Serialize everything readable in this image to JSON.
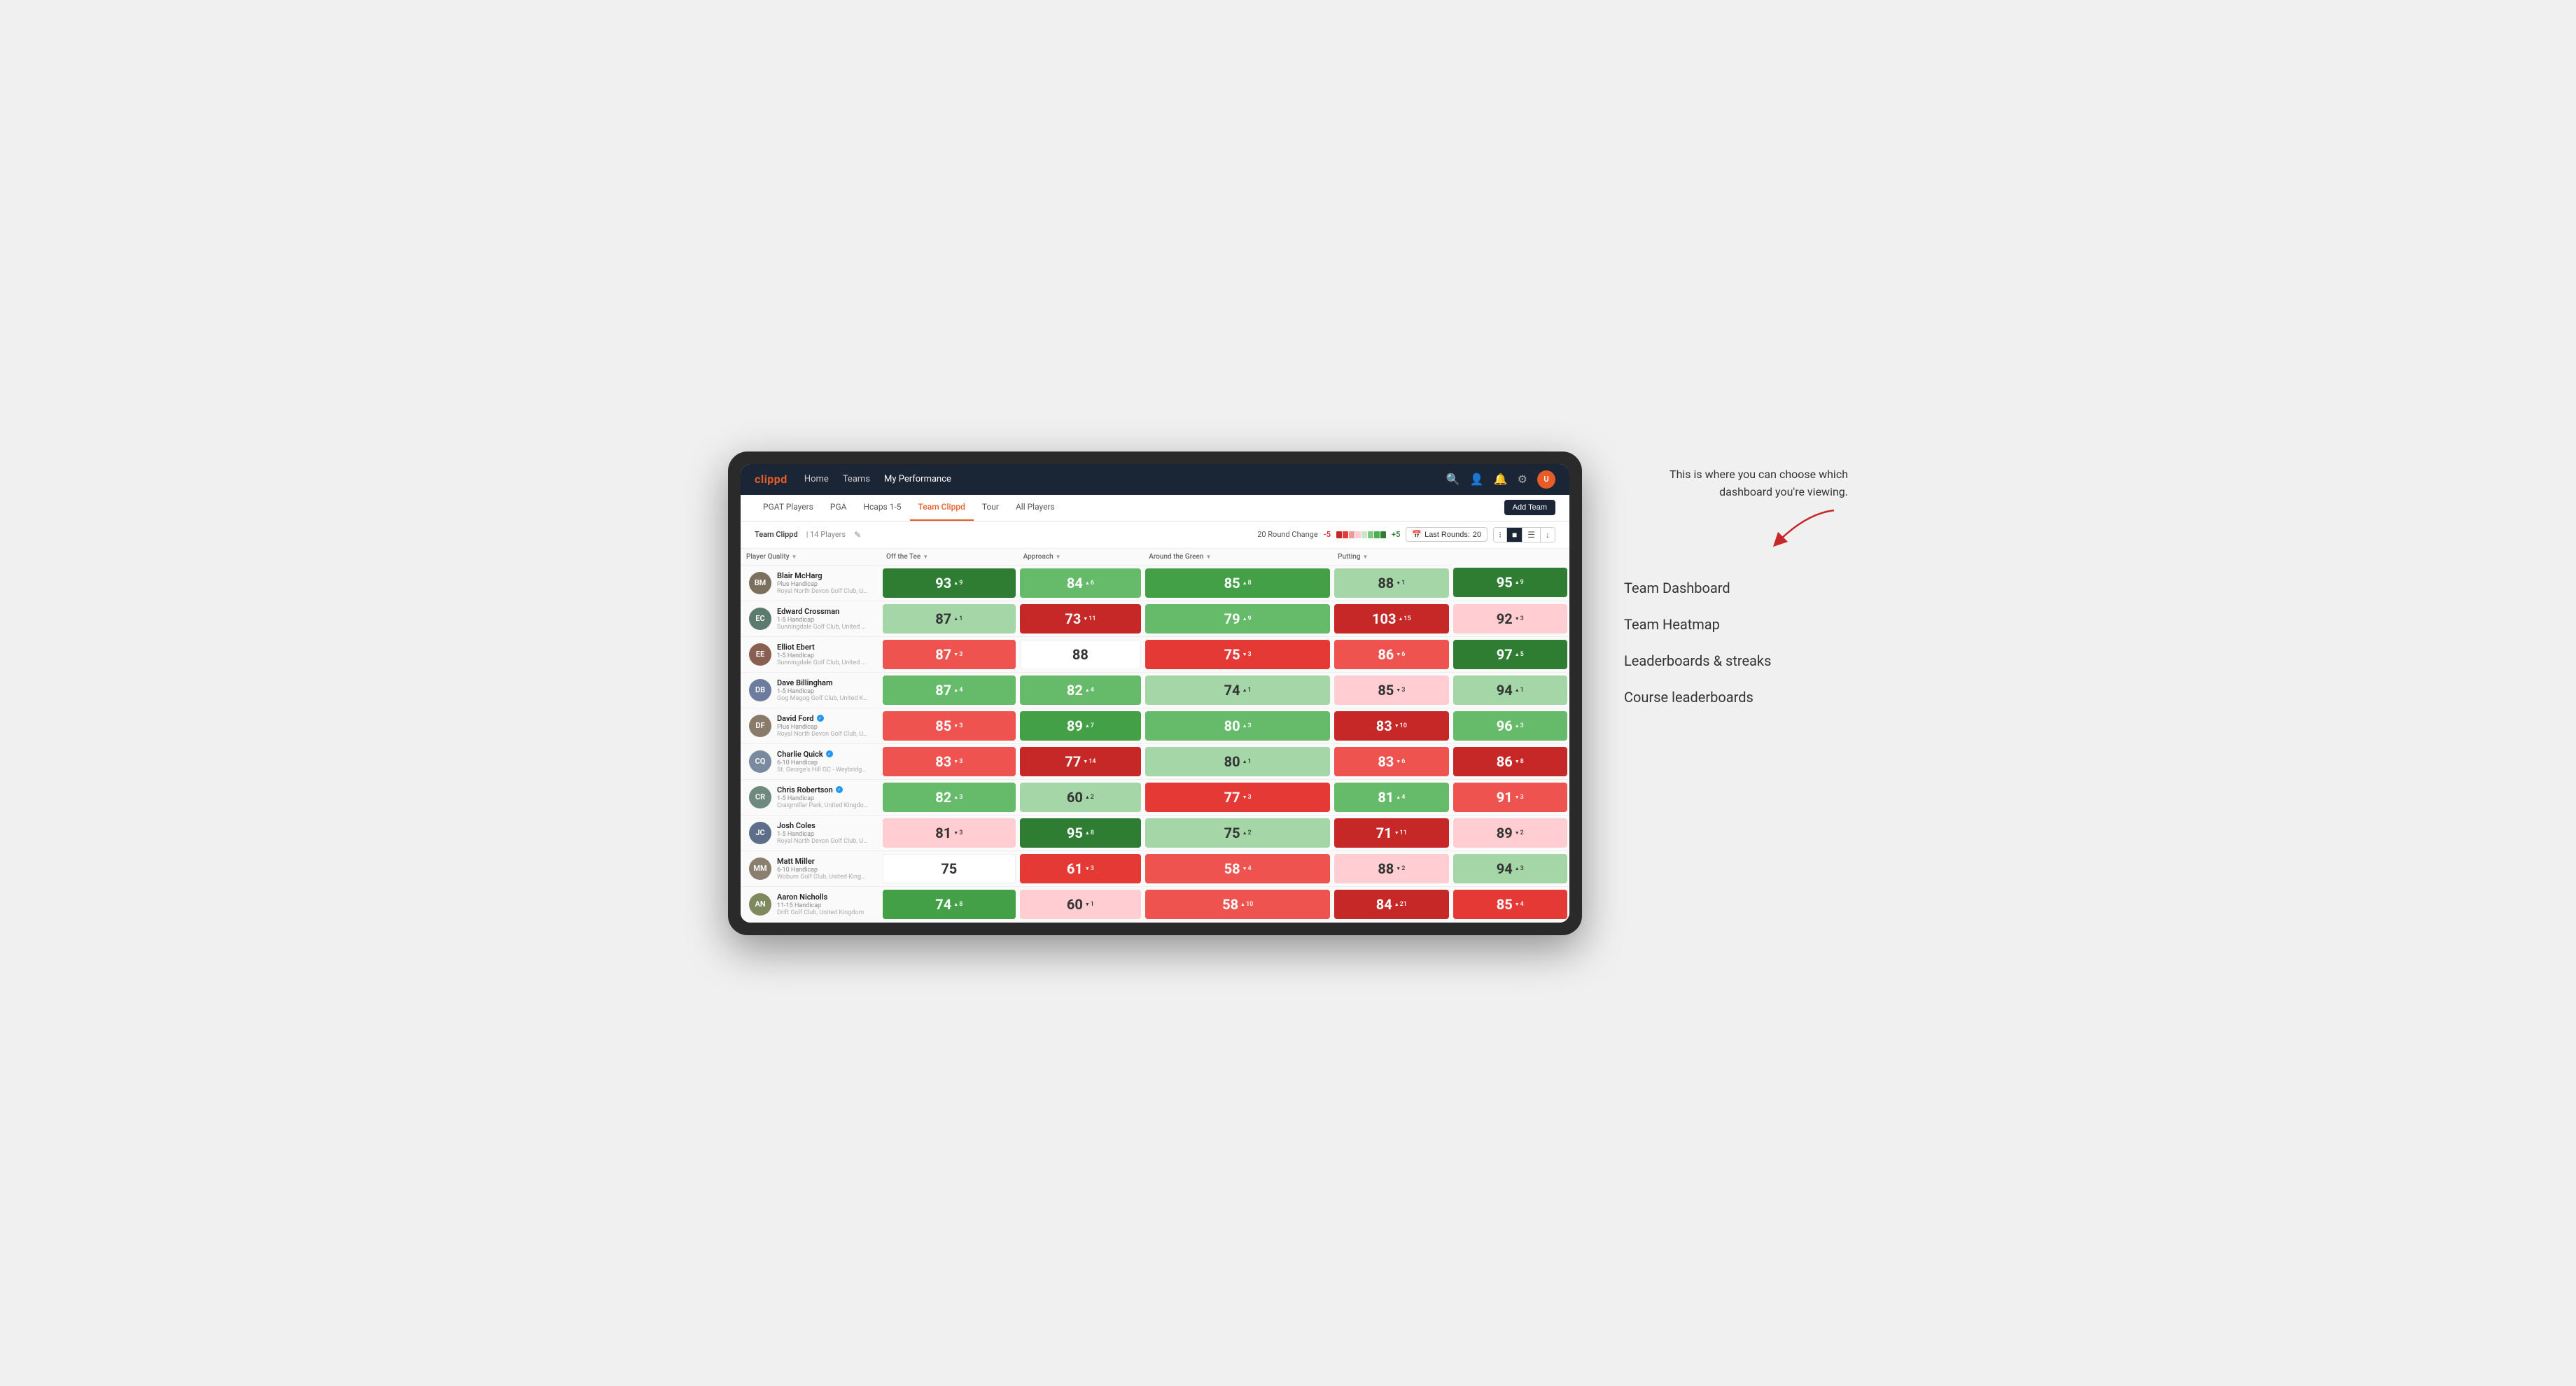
{
  "annotation": {
    "intro_text": "This is where you can choose which dashboard you're viewing.",
    "items": [
      {
        "label": "Team Dashboard"
      },
      {
        "label": "Team Heatmap"
      },
      {
        "label": "Leaderboards & streaks"
      },
      {
        "label": "Course leaderboards"
      }
    ]
  },
  "app": {
    "logo": "clippd",
    "nav_links": [
      {
        "label": "Home",
        "active": false
      },
      {
        "label": "Teams",
        "active": false
      },
      {
        "label": "My Performance",
        "active": true
      }
    ],
    "sub_nav_links": [
      {
        "label": "PGAT Players",
        "active": false
      },
      {
        "label": "PGA",
        "active": false
      },
      {
        "label": "Hcaps 1-5",
        "active": false
      },
      {
        "label": "Team Clippd",
        "active": true
      },
      {
        "label": "Tour",
        "active": false
      },
      {
        "label": "All Players",
        "active": false
      }
    ],
    "add_team_label": "Add Team"
  },
  "team_header": {
    "team_name": "Team Clippd",
    "separator": "|",
    "player_count": "14 Players",
    "round_change_label": "20 Round Change",
    "neg_val": "-5",
    "pos_val": "+5",
    "last_rounds_label": "Last Rounds:",
    "last_rounds_value": "20"
  },
  "table": {
    "columns": [
      {
        "id": "player",
        "label": "Player Quality",
        "sortable": true
      },
      {
        "id": "off_tee",
        "label": "Off the Tee",
        "sortable": true
      },
      {
        "id": "approach",
        "label": "Approach",
        "sortable": true
      },
      {
        "id": "around_green",
        "label": "Around the Green",
        "sortable": true
      },
      {
        "id": "putting",
        "label": "Putting",
        "sortable": true
      }
    ],
    "rows": [
      {
        "name": "Blair McHarg",
        "handicap": "Plus Handicap",
        "club": "Royal North Devon Golf Club, United Kingdom",
        "avatar_color": "#7b6f5e",
        "initials": "BM",
        "scores": [
          {
            "value": "93",
            "delta": "9",
            "dir": "up",
            "color": "green-strong"
          },
          {
            "value": "84",
            "delta": "6",
            "dir": "up",
            "color": "green-light"
          },
          {
            "value": "85",
            "delta": "8",
            "dir": "up",
            "color": "green-mid"
          },
          {
            "value": "88",
            "delta": "1",
            "dir": "down",
            "color": "green-pale"
          },
          {
            "value": "95",
            "delta": "9",
            "dir": "up",
            "color": "green-strong"
          }
        ]
      },
      {
        "name": "Edward Crossman",
        "handicap": "1-5 Handicap",
        "club": "Sunningdale Golf Club, United Kingdom",
        "avatar_color": "#5c7a6e",
        "initials": "EC",
        "scores": [
          {
            "value": "87",
            "delta": "1",
            "dir": "up",
            "color": "green-pale"
          },
          {
            "value": "73",
            "delta": "11",
            "dir": "down",
            "color": "red-strong"
          },
          {
            "value": "79",
            "delta": "9",
            "dir": "up",
            "color": "green-light"
          },
          {
            "value": "103",
            "delta": "15",
            "dir": "up",
            "color": "red-strong"
          },
          {
            "value": "92",
            "delta": "3",
            "dir": "down",
            "color": "red-pale"
          }
        ]
      },
      {
        "name": "Elliot Ebert",
        "handicap": "1-5 Handicap",
        "club": "Sunningdale Golf Club, United Kingdom",
        "avatar_color": "#8b5e52",
        "initials": "EE",
        "scores": [
          {
            "value": "87",
            "delta": "3",
            "dir": "down",
            "color": "red-light"
          },
          {
            "value": "88",
            "delta": "",
            "dir": "",
            "color": "white"
          },
          {
            "value": "75",
            "delta": "3",
            "dir": "down",
            "color": "red-mid"
          },
          {
            "value": "86",
            "delta": "6",
            "dir": "down",
            "color": "red-light"
          },
          {
            "value": "97",
            "delta": "5",
            "dir": "up",
            "color": "green-strong"
          }
        ]
      },
      {
        "name": "Dave Billingham",
        "handicap": "1-5 Handicap",
        "club": "Gog Magog Golf Club, United Kingdom",
        "avatar_color": "#6b7c9e",
        "initials": "DB",
        "scores": [
          {
            "value": "87",
            "delta": "4",
            "dir": "up",
            "color": "green-light"
          },
          {
            "value": "82",
            "delta": "4",
            "dir": "up",
            "color": "green-light"
          },
          {
            "value": "74",
            "delta": "1",
            "dir": "up",
            "color": "green-pale"
          },
          {
            "value": "85",
            "delta": "3",
            "dir": "down",
            "color": "red-pale"
          },
          {
            "value": "94",
            "delta": "1",
            "dir": "up",
            "color": "green-pale"
          }
        ]
      },
      {
        "name": "David Ford",
        "handicap": "Plus Handicap",
        "club": "Royal North Devon Golf Club, United Kingdom",
        "avatar_color": "#8a7a6a",
        "initials": "DF",
        "verified": true,
        "scores": [
          {
            "value": "85",
            "delta": "3",
            "dir": "down",
            "color": "red-light"
          },
          {
            "value": "89",
            "delta": "7",
            "dir": "up",
            "color": "green-mid"
          },
          {
            "value": "80",
            "delta": "3",
            "dir": "up",
            "color": "green-light"
          },
          {
            "value": "83",
            "delta": "10",
            "dir": "down",
            "color": "red-strong"
          },
          {
            "value": "96",
            "delta": "3",
            "dir": "up",
            "color": "green-light"
          }
        ]
      },
      {
        "name": "Charlie Quick",
        "handicap": "6-10 Handicap",
        "club": "St. George's Hill GC - Weybridge - Surrey, Uni...",
        "avatar_color": "#7a8a9e",
        "initials": "CQ",
        "verified": true,
        "scores": [
          {
            "value": "83",
            "delta": "3",
            "dir": "down",
            "color": "red-light"
          },
          {
            "value": "77",
            "delta": "14",
            "dir": "down",
            "color": "red-strong"
          },
          {
            "value": "80",
            "delta": "1",
            "dir": "up",
            "color": "green-pale"
          },
          {
            "value": "83",
            "delta": "6",
            "dir": "down",
            "color": "red-light"
          },
          {
            "value": "86",
            "delta": "8",
            "dir": "down",
            "color": "red-strong"
          }
        ]
      },
      {
        "name": "Chris Robertson",
        "handicap": "1-5 Handicap",
        "club": "Craigmillar Park, United Kingdom",
        "avatar_color": "#6e8a7e",
        "initials": "CR",
        "verified": true,
        "scores": [
          {
            "value": "82",
            "delta": "3",
            "dir": "up",
            "color": "green-light"
          },
          {
            "value": "60",
            "delta": "2",
            "dir": "up",
            "color": "green-pale"
          },
          {
            "value": "77",
            "delta": "3",
            "dir": "down",
            "color": "red-mid"
          },
          {
            "value": "81",
            "delta": "4",
            "dir": "up",
            "color": "green-light"
          },
          {
            "value": "91",
            "delta": "3",
            "dir": "down",
            "color": "red-light"
          }
        ]
      },
      {
        "name": "Josh Coles",
        "handicap": "1-5 Handicap",
        "club": "Royal North Devon Golf Club, United Kingdom",
        "avatar_color": "#5e6e8a",
        "initials": "JC",
        "scores": [
          {
            "value": "81",
            "delta": "3",
            "dir": "down",
            "color": "red-pale"
          },
          {
            "value": "95",
            "delta": "8",
            "dir": "up",
            "color": "green-strong"
          },
          {
            "value": "75",
            "delta": "2",
            "dir": "up",
            "color": "green-pale"
          },
          {
            "value": "71",
            "delta": "11",
            "dir": "down",
            "color": "red-strong"
          },
          {
            "value": "89",
            "delta": "2",
            "dir": "down",
            "color": "red-pale"
          }
        ]
      },
      {
        "name": "Matt Miller",
        "handicap": "6-10 Handicap",
        "club": "Woburn Golf Club, United Kingdom",
        "avatar_color": "#8a7e6e",
        "initials": "MM",
        "scores": [
          {
            "value": "75",
            "delta": "",
            "dir": "",
            "color": "white"
          },
          {
            "value": "61",
            "delta": "3",
            "dir": "down",
            "color": "red-mid"
          },
          {
            "value": "58",
            "delta": "4",
            "dir": "down",
            "color": "red-light"
          },
          {
            "value": "88",
            "delta": "2",
            "dir": "down",
            "color": "red-pale"
          },
          {
            "value": "94",
            "delta": "3",
            "dir": "up",
            "color": "green-pale"
          }
        ]
      },
      {
        "name": "Aaron Nicholls",
        "handicap": "11-15 Handicap",
        "club": "Drift Golf Club, United Kingdom",
        "avatar_color": "#7e8a5e",
        "initials": "AN",
        "scores": [
          {
            "value": "74",
            "delta": "8",
            "dir": "up",
            "color": "green-mid"
          },
          {
            "value": "60",
            "delta": "1",
            "dir": "down",
            "color": "red-pale"
          },
          {
            "value": "58",
            "delta": "10",
            "dir": "up",
            "color": "red-light"
          },
          {
            "value": "84",
            "delta": "21",
            "dir": "up",
            "color": "red-strong"
          },
          {
            "value": "85",
            "delta": "4",
            "dir": "down",
            "color": "red-mid"
          }
        ]
      }
    ]
  },
  "colors": {
    "green_strong": "#2e7d32",
    "green_mid": "#43a047",
    "green_light": "#66bb6a",
    "green_pale": "#a5d6a7",
    "red_strong": "#c62828",
    "red_mid": "#e53935",
    "red_light": "#ef5350",
    "red_pale": "#ffcdd2",
    "white": "#ffffff"
  }
}
